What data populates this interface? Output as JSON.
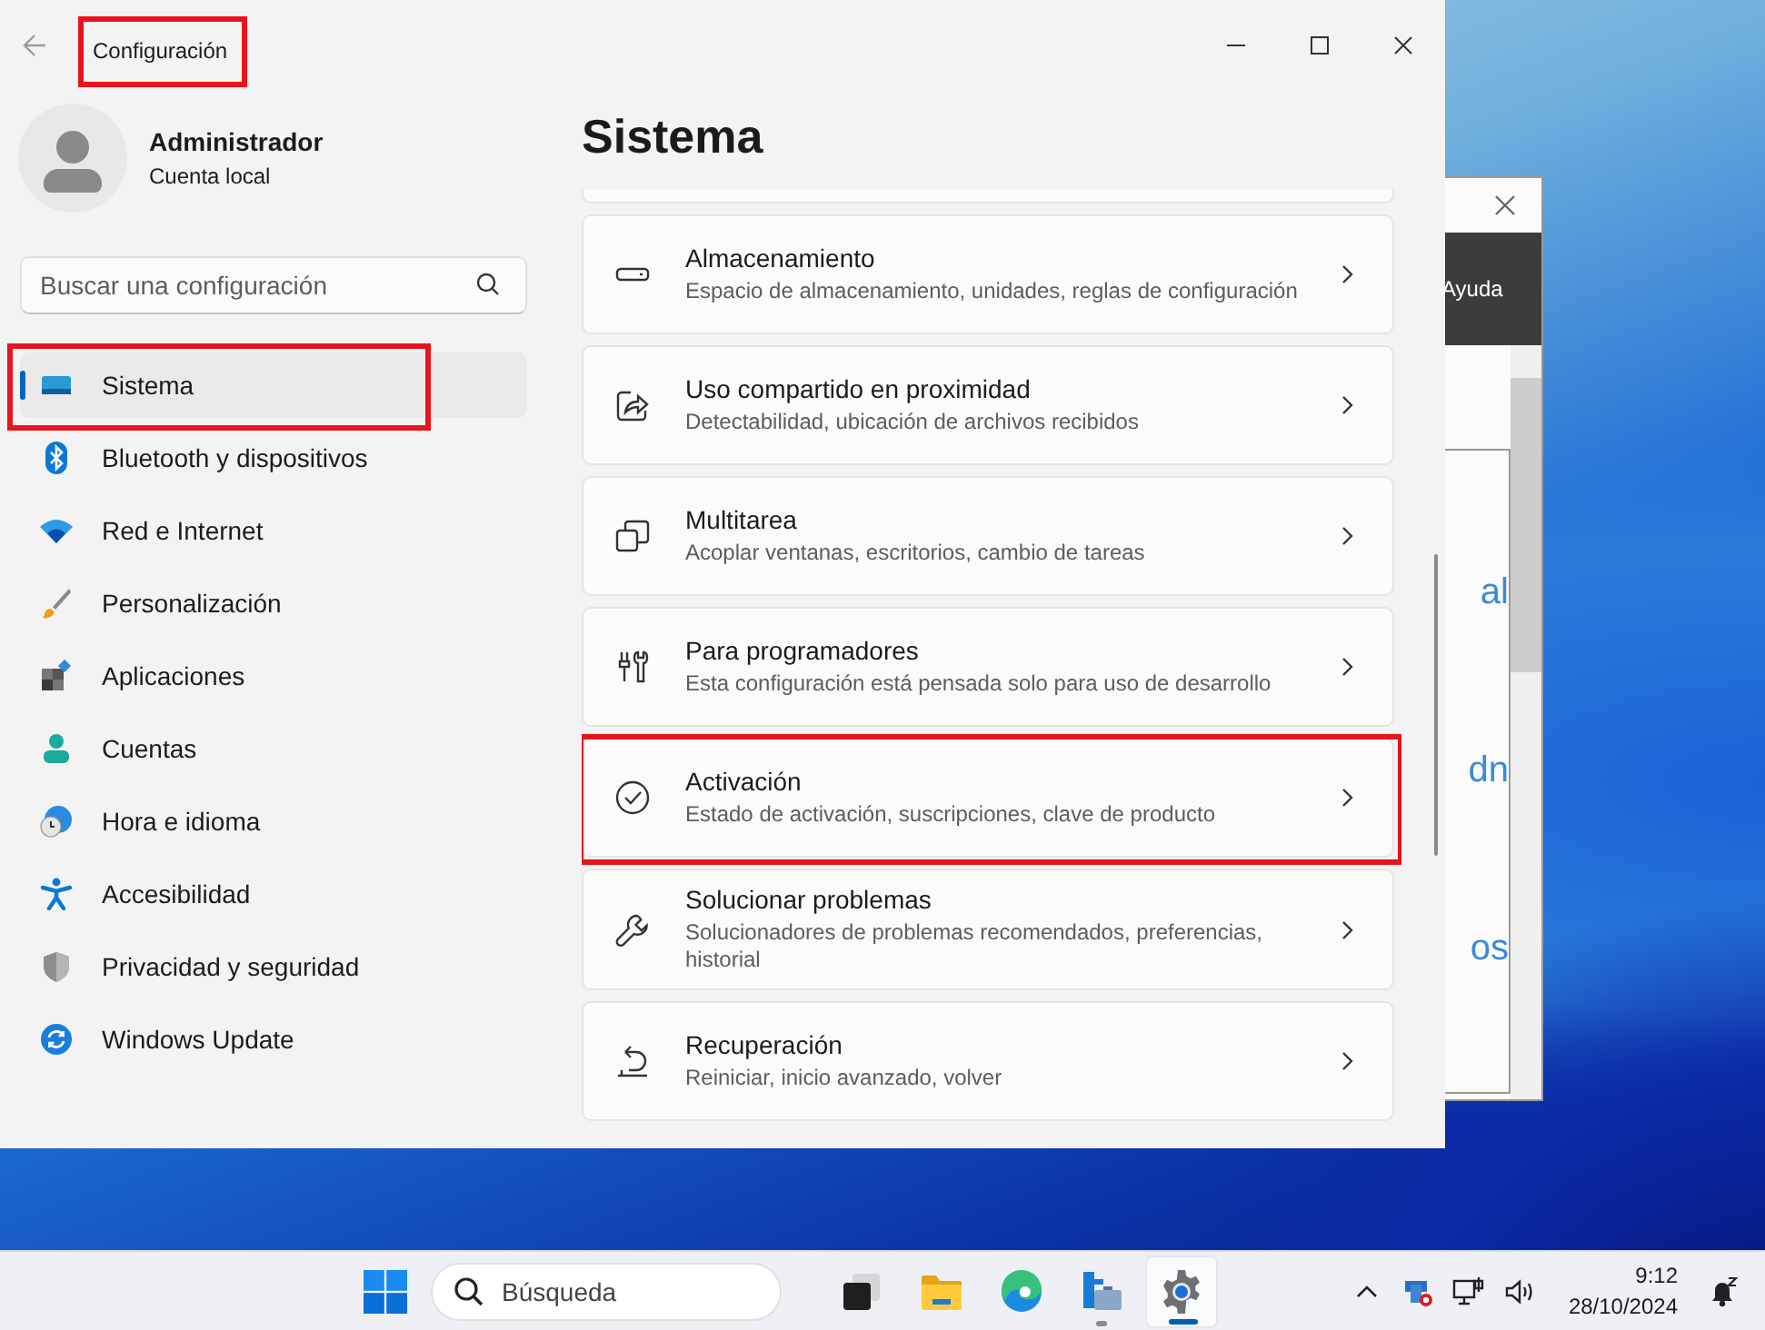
{
  "settings_window": {
    "title": "Configuración",
    "title_highlighted": true,
    "user": {
      "name": "Administrador",
      "account": "Cuenta local"
    },
    "search": {
      "placeholder": "Buscar una configuración"
    },
    "nav": [
      {
        "kind": "system",
        "label": "Sistema",
        "selected": true,
        "highlighted": true
      },
      {
        "kind": "bluetooth",
        "label": "Bluetooth y dispositivos",
        "selected": false,
        "highlighted": false
      },
      {
        "kind": "network",
        "label": "Red e Internet",
        "selected": false,
        "highlighted": false
      },
      {
        "kind": "personalization",
        "label": "Personalización",
        "selected": false,
        "highlighted": false
      },
      {
        "kind": "apps",
        "label": "Aplicaciones",
        "selected": false,
        "highlighted": false
      },
      {
        "kind": "accounts",
        "label": "Cuentas",
        "selected": false,
        "highlighted": false
      },
      {
        "kind": "time",
        "label": "Hora e idioma",
        "selected": false,
        "highlighted": false
      },
      {
        "kind": "accessibility",
        "label": "Accesibilidad",
        "selected": false,
        "highlighted": false
      },
      {
        "kind": "privacy",
        "label": "Privacidad y seguridad",
        "selected": false,
        "highlighted": false
      },
      {
        "kind": "update",
        "label": "Windows Update",
        "selected": false,
        "highlighted": false
      }
    ],
    "heading": "Sistema",
    "cards": [
      {
        "kind": "storage",
        "title": "Almacenamiento",
        "subtitle": "Espacio de almacenamiento, unidades, reglas de configuración",
        "highlighted": false
      },
      {
        "kind": "share",
        "title": "Uso compartido en proximidad",
        "subtitle": "Detectabilidad, ubicación de archivos recibidos",
        "highlighted": false
      },
      {
        "kind": "multitask",
        "title": "Multitarea",
        "subtitle": "Acoplar ventanas, escritorios, cambio de tareas",
        "highlighted": false
      },
      {
        "kind": "developer",
        "title": "Para programadores",
        "subtitle": "Esta configuración está pensada solo para uso de desarrollo",
        "highlighted": false
      },
      {
        "kind": "activation",
        "title": "Activación",
        "subtitle": "Estado de activación, suscripciones, clave de producto",
        "highlighted": true
      },
      {
        "kind": "troubleshoot",
        "title": "Solucionar problemas",
        "subtitle": "Solucionadores de problemas recomendados, preferencias, historial",
        "highlighted": false
      },
      {
        "kind": "recovery",
        "title": "Recuperación",
        "subtitle": "Reiniciar, inicio avanzado, volver",
        "highlighted": false
      }
    ]
  },
  "background_window": {
    "menu_item": "Ayuda",
    "text_fragments": [
      "al",
      "dn",
      "os"
    ]
  },
  "taskbar": {
    "search": {
      "placeholder": "Búsqueda"
    },
    "apps": [
      {
        "kind": "task-view",
        "running": false,
        "selected": false
      },
      {
        "kind": "explorer",
        "running": false,
        "selected": false
      },
      {
        "kind": "edge",
        "running": false,
        "selected": false
      },
      {
        "kind": "network-tool",
        "running": true,
        "selected": false
      },
      {
        "kind": "settings",
        "running": true,
        "selected": true
      }
    ],
    "clock": {
      "time": "9:12",
      "date": "28/10/2024"
    }
  }
}
